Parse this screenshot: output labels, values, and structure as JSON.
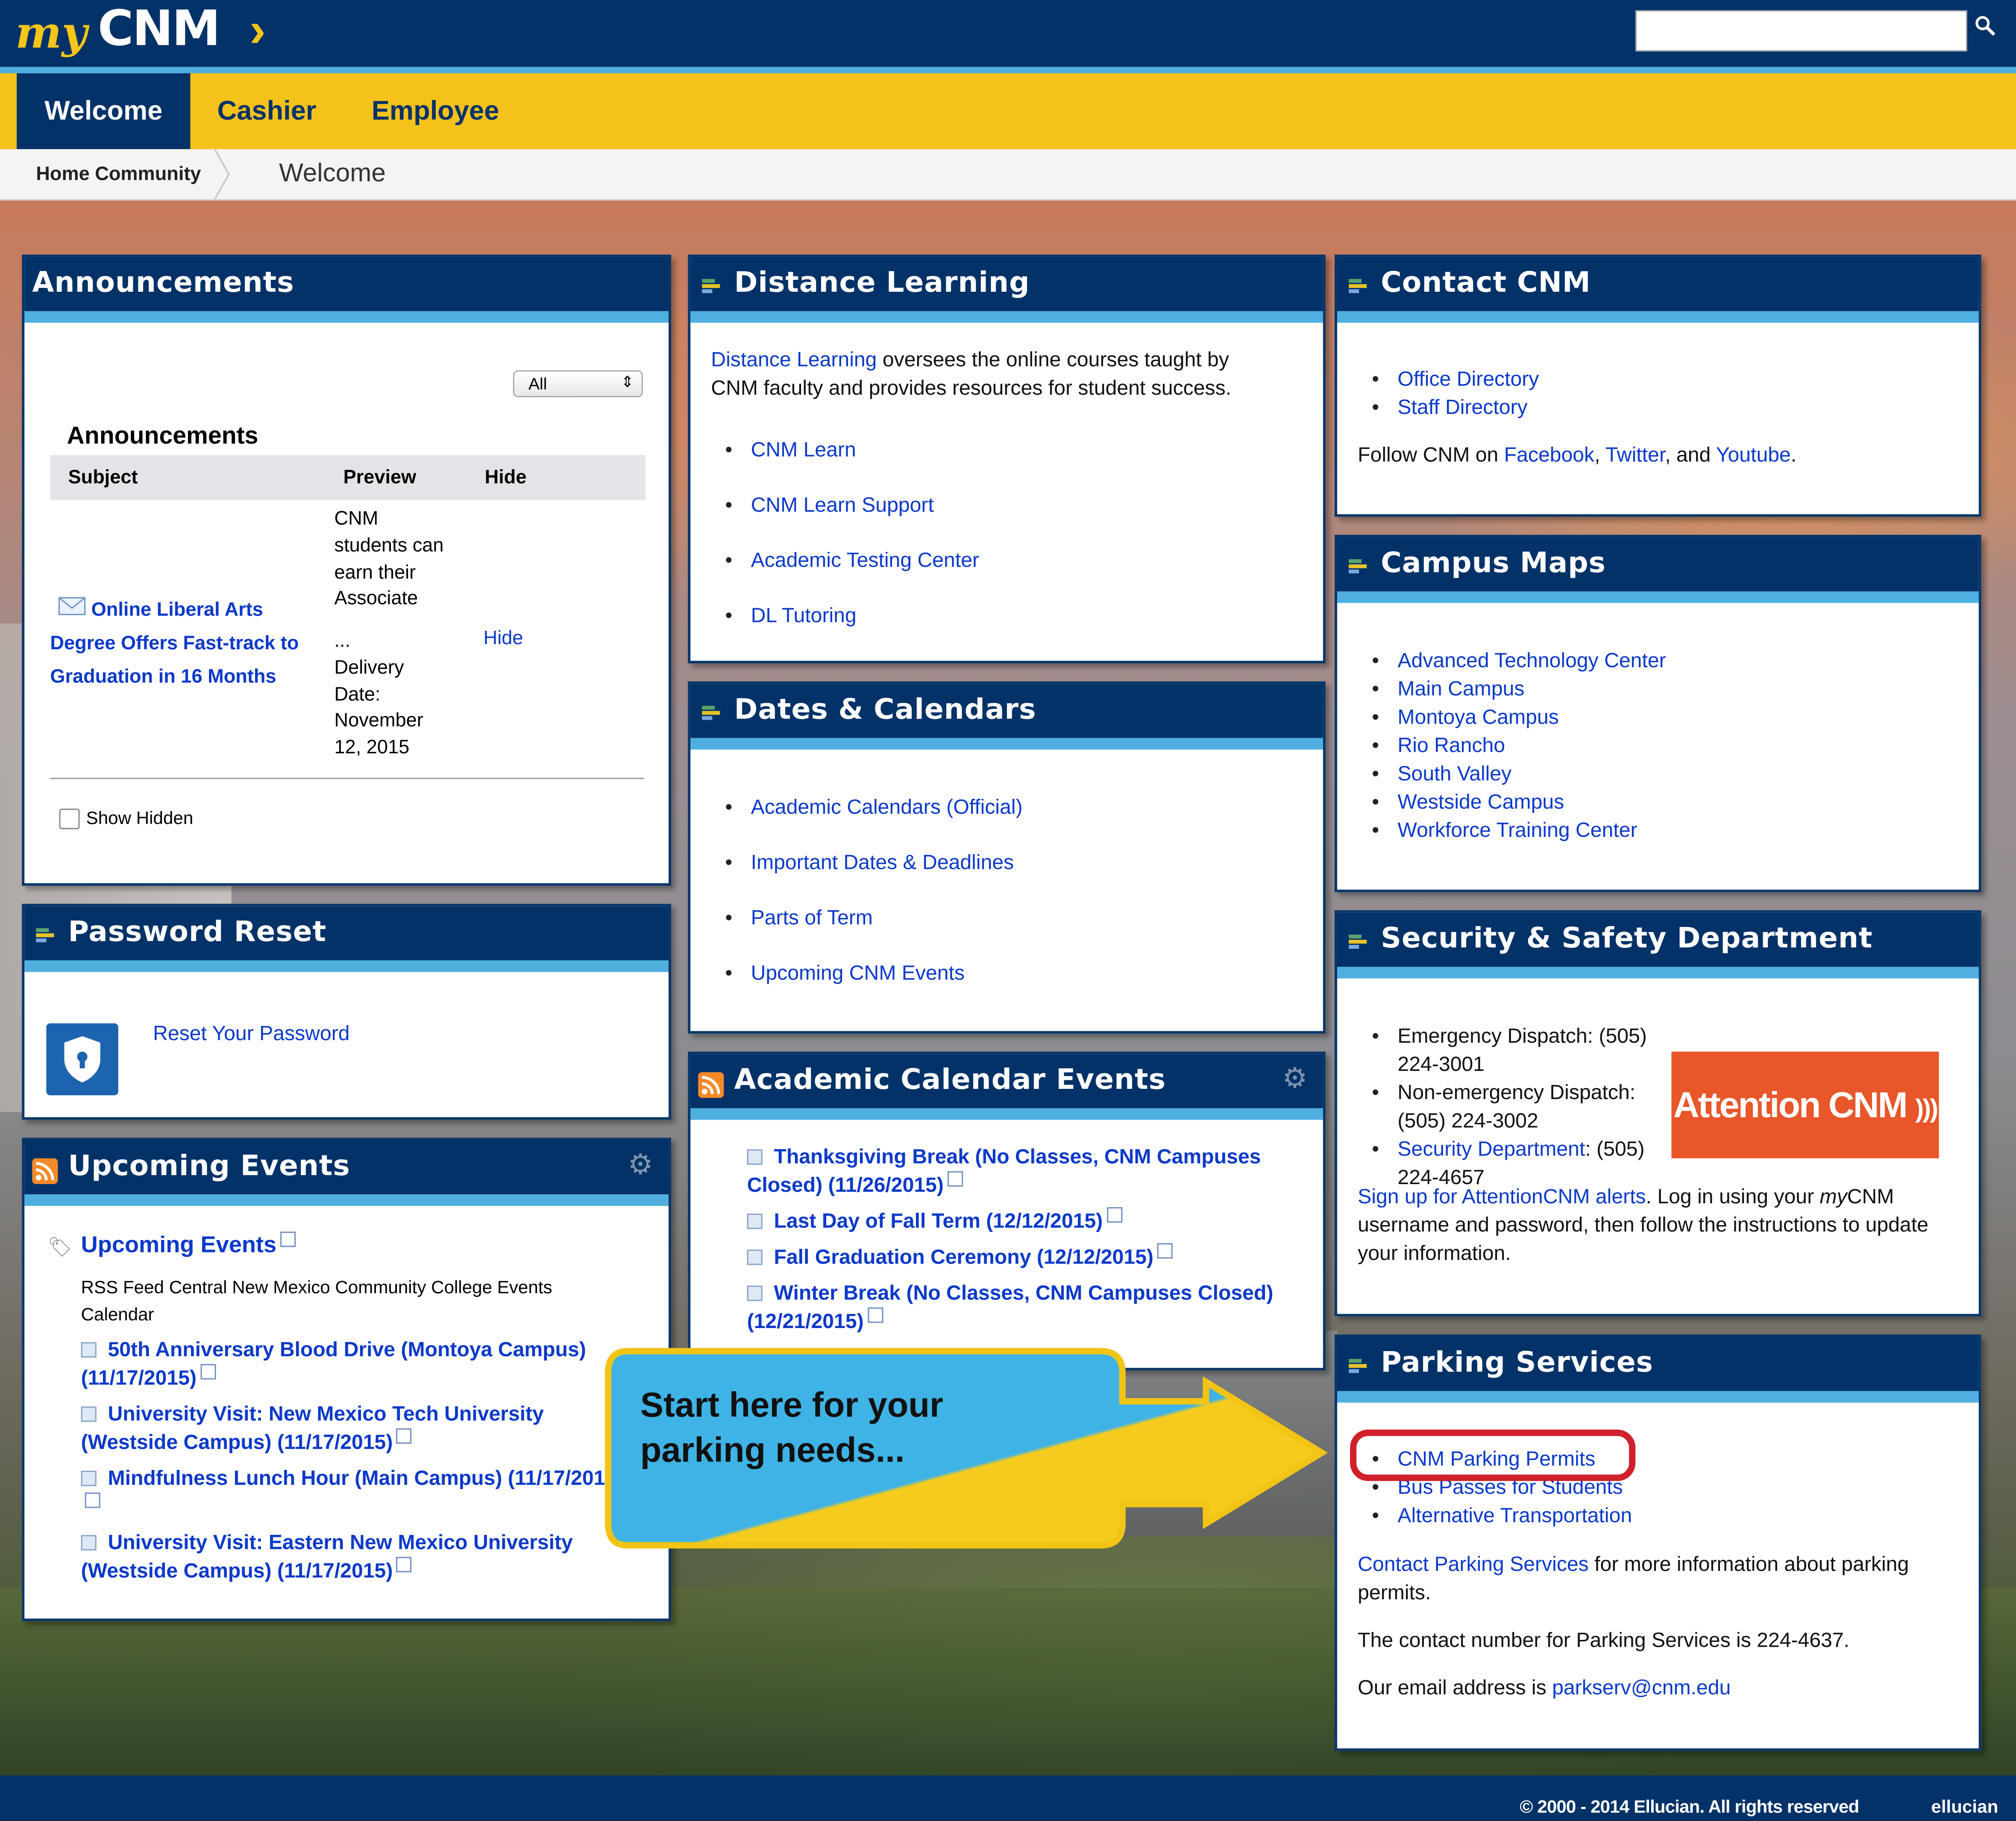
{
  "header": {
    "logo_my": "my",
    "logo_cnm": "CNM",
    "search_placeholder": ""
  },
  "tabs": [
    "Welcome",
    "Cashier",
    "Employee"
  ],
  "breadcrumb": {
    "home": "Home Community",
    "current": "Welcome"
  },
  "announcements": {
    "panel_title": "Announcements",
    "filter_value": "All",
    "table_title": "Announcements",
    "columns": [
      "Subject",
      "Preview",
      "Hide"
    ],
    "rows": [
      {
        "subject": "Online Liberal Arts Degree Offers Fast-track to Graduation in 16 Months",
        "preview_lines": [
          "CNM",
          "students can",
          "earn their",
          "Associate",
          "",
          "...",
          "Delivery",
          "Date:",
          "November",
          "12, 2015"
        ],
        "hide": "Hide"
      }
    ],
    "show_hidden_label": "Show Hidden"
  },
  "password_reset": {
    "panel_title": "Password Reset",
    "link": "Reset Your Password"
  },
  "upcoming_events": {
    "panel_title": "Upcoming Events",
    "feed_title": "Upcoming Events",
    "feed_desc": "RSS Feed Central New Mexico Community College Events Calendar",
    "events": [
      "50th Anniversary Blood Drive (Montoya Campus) (11/17/2015)",
      "University Visit: New Mexico Tech University (Westside Campus) (11/17/2015)",
      "Mindfulness Lunch Hour (Main Campus) (11/17/2015)",
      "University Visit: Eastern New Mexico University (Westside Campus) (11/17/2015)"
    ]
  },
  "distance_learning": {
    "panel_title": "Distance Learning",
    "intro_link": "Distance Learning",
    "intro_text": " oversees the online courses taught by CNM faculty and provides resources for student success.",
    "links": [
      "CNM Learn",
      "CNM Learn Support",
      "Academic Testing Center",
      "DL Tutoring"
    ]
  },
  "dates_calendars": {
    "panel_title": "Dates & Calendars",
    "links": [
      "Academic Calendars (Official)",
      "Important Dates & Deadlines",
      "Parts of Term",
      "Upcoming CNM Events"
    ]
  },
  "academic_events": {
    "panel_title": "Academic Calendar Events",
    "events": [
      "Thanksgiving Break (No Classes, CNM Campuses Closed) (11/26/2015)",
      "Last Day of Fall Term (12/12/2015)",
      "Fall Graduation Ceremony (12/12/2015)",
      "Winter Break (No Classes, CNM Campuses Closed) (12/21/2015)"
    ]
  },
  "contact": {
    "panel_title": "Contact CNM",
    "links": [
      "Office Directory",
      "Staff Directory"
    ],
    "follow_prefix": "Follow CNM on ",
    "facebook": "Facebook",
    "twitter": "Twitter",
    "and": ", and ",
    "comma": ", ",
    "youtube": "Youtube",
    "period": "."
  },
  "campus_maps": {
    "panel_title": "Campus Maps",
    "links": [
      "Advanced Technology Center",
      "Main Campus",
      "Montoya Campus",
      "Rio Rancho",
      "South Valley",
      "Westside Campus",
      "Workforce Training Center"
    ]
  },
  "security": {
    "panel_title": "Security & Safety Department",
    "emergency": "Emergency Dispatch: (505) 224-3001",
    "nonemergency_1": "Non-emergency Dispatch:",
    "nonemergency_2": "(505) 224-3002",
    "dept_link": "Security Department",
    "dept_phone_1": ": (505)",
    "dept_phone_2": "224-4657",
    "attention_label": "Attention CNM",
    "signup_link": "Sign up for AttentionCNM alerts",
    "signup_text_1": ". Log in using your ",
    "signup_my": "my",
    "signup_text_2": "CNM username and password, then follow the instructions to update your information."
  },
  "parking": {
    "panel_title": "Parking Services",
    "links": [
      "CNM Parking Permits",
      "Bus Passes for Students",
      "Alternative Transportation"
    ],
    "contact_link": "Contact Parking Services",
    "contact_text": " for more information about parking permits.",
    "phone_text": "The contact number for Parking Services is 224-4637.",
    "email_prefix": "Our email address is ",
    "email": "parkserv@cnm.edu"
  },
  "callout": {
    "text": "Start here for your parking needs..."
  },
  "footer": {
    "copyright": "© 2000 - 2014 Ellucian. All rights reserved",
    "brand": "ellucian"
  },
  "colors": {
    "navy": "#033268",
    "accent": "#4fb0e0",
    "gold": "#f5c21c",
    "link": "#0b39c9",
    "attention": "#e8562a",
    "highlight": "#d0202a",
    "callout": "#3fb3e5"
  }
}
